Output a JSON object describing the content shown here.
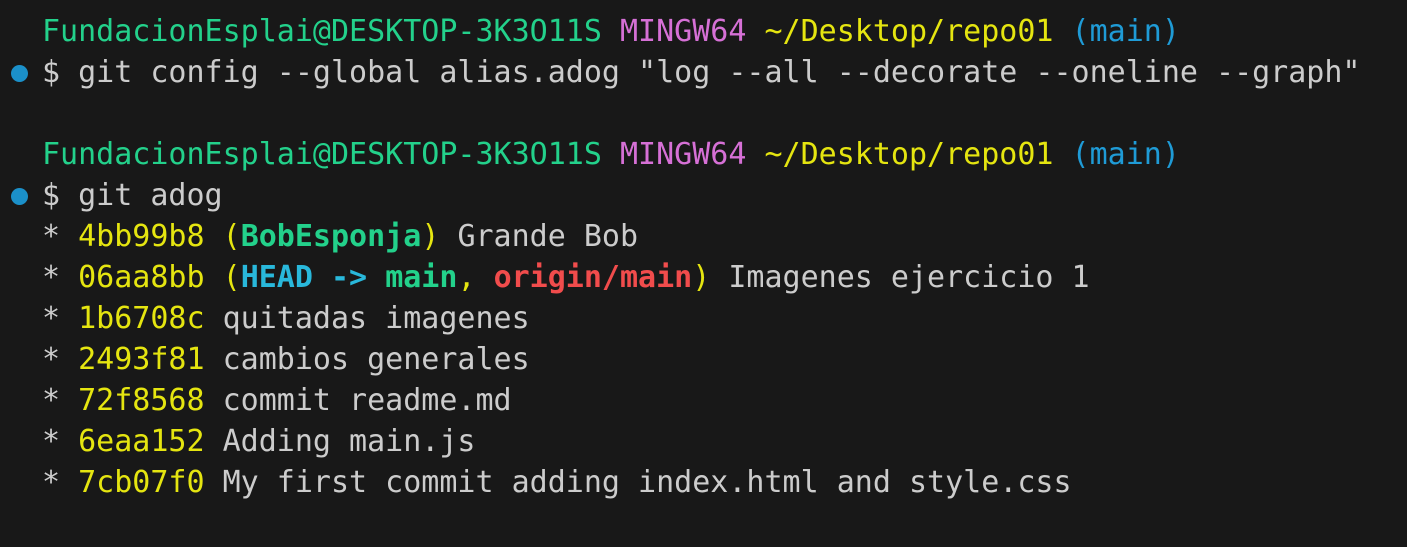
{
  "prompt": {
    "user_host": "FundacionEsplai@DESKTOP-3K3O11S",
    "system": "MINGW64",
    "path": "~/Desktop/repo01",
    "branch": "(main)",
    "symbol": "$"
  },
  "commands": [
    "git config --global alias.adog \"log --all --decorate --oneline --graph\"",
    "git adog"
  ],
  "log": {
    "graph_marker": "*",
    "entries": [
      {
        "hash": "4bb99b8",
        "paren_open": "(",
        "ref_local": "BobEsponja",
        "paren_close": ")",
        "message": "Grande Bob"
      },
      {
        "hash": "06aa8bb",
        "paren_open": "(",
        "ref_head": "HEAD",
        "ref_arrow": " -> ",
        "ref_local": "main",
        "ref_sep": ", ",
        "ref_remote": "origin/main",
        "paren_close": ")",
        "message": "Imagenes ejercicio 1"
      },
      {
        "hash": "1b6708c",
        "message": "quitadas imagenes"
      },
      {
        "hash": "2493f81",
        "message": "cambios generales"
      },
      {
        "hash": "72f8568",
        "message": "commit readme.md"
      },
      {
        "hash": "6eaa152",
        "message": "Adding main.js"
      },
      {
        "hash": "7cb07f0",
        "message": "My first commit adding index.html and style.css"
      }
    ]
  },
  "colors": {
    "background": "#181818",
    "user_host": "#23d18b",
    "system": "#d670d6",
    "path": "#e5e510",
    "branch": "#1f9bd6",
    "command_dot": "#1b90c9",
    "text": "#cccccc",
    "head": "#29b8db",
    "remote": "#f14c4c"
  }
}
